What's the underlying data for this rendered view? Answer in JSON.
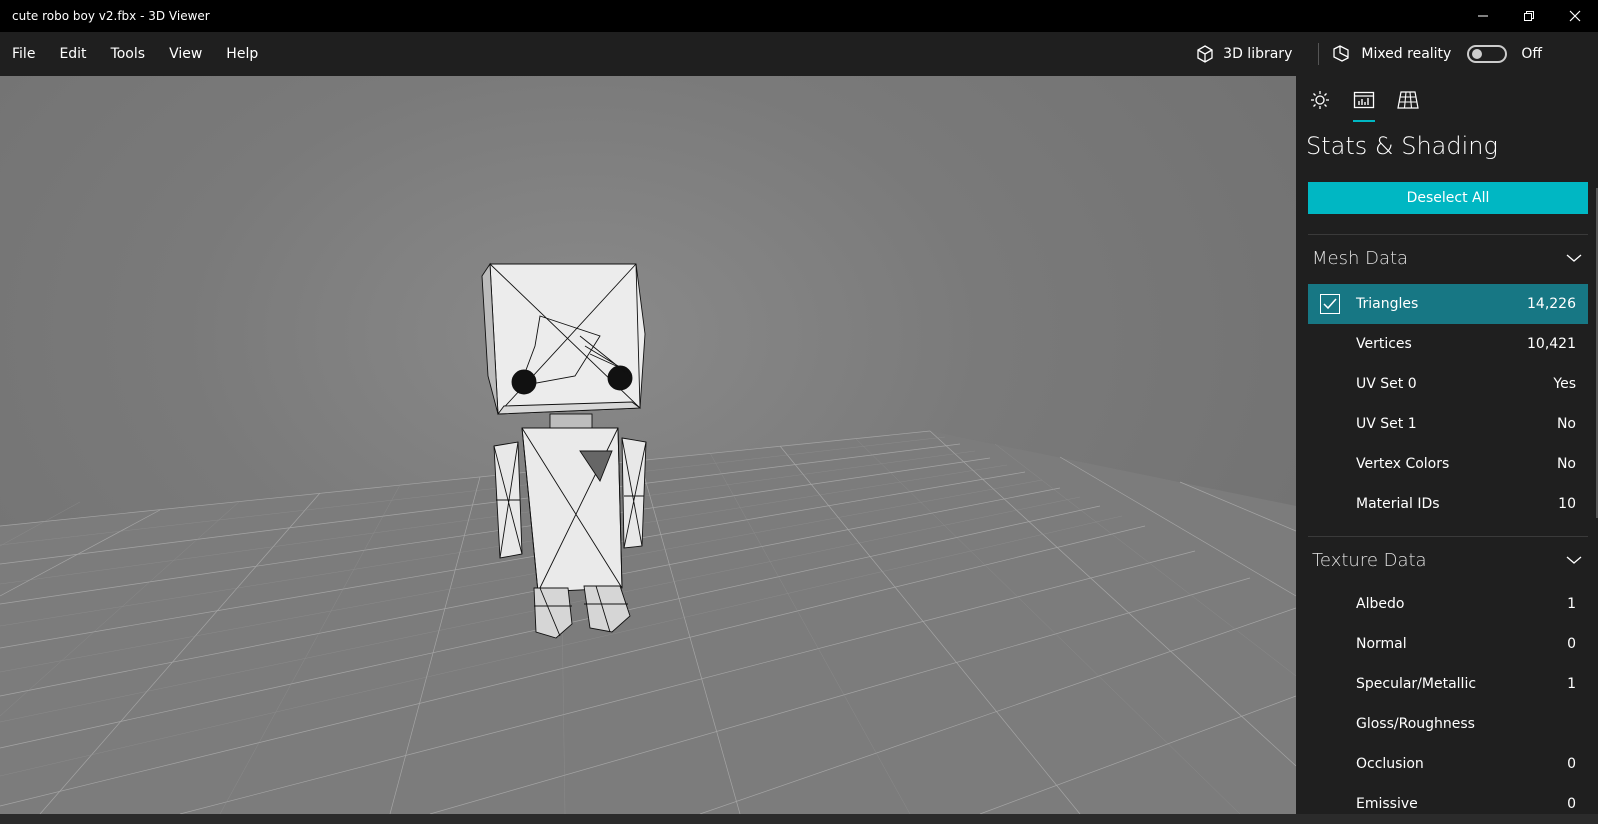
{
  "window": {
    "title": "cute robo boy v2.fbx - 3D Viewer"
  },
  "menu": {
    "file": "File",
    "edit": "Edit",
    "tools": "Tools",
    "view": "View",
    "help": "Help"
  },
  "toolbar_right": {
    "library_label": "3D library",
    "mixed_reality_label": "Mixed reality",
    "mixed_reality_state": "Off"
  },
  "panel": {
    "title": "Stats & Shading",
    "deselect_label": "Deselect All",
    "mesh_section": {
      "label": "Mesh Data",
      "rows": [
        {
          "label": "Triangles",
          "value": "14,226",
          "checked": true
        },
        {
          "label": "Vertices",
          "value": "10,421"
        },
        {
          "label": "UV Set 0",
          "value": "Yes"
        },
        {
          "label": "UV Set 1",
          "value": "No"
        },
        {
          "label": "Vertex Colors",
          "value": "No"
        },
        {
          "label": "Material IDs",
          "value": "10"
        }
      ]
    },
    "texture_section": {
      "label": "Texture Data",
      "rows": [
        {
          "label": "Albedo",
          "value": "1"
        },
        {
          "label": "Normal",
          "value": "0"
        },
        {
          "label": "Specular/Metallic",
          "value": "1"
        },
        {
          "label": "Gloss/Roughness",
          "value": ""
        },
        {
          "label": "Occlusion",
          "value": "0"
        },
        {
          "label": "Emissive",
          "value": "0"
        }
      ]
    }
  },
  "colors": {
    "accent": "#00b7c3",
    "selected_row": "#177784",
    "panel_bg": "#1f1f1f"
  },
  "icons": [
    "cube-library-icon",
    "mixed-reality-icon",
    "sun-lighting-icon",
    "stats-chart-icon",
    "grid-icon",
    "chevron-down-icon",
    "checkbox-icon",
    "minimize-icon",
    "restore-icon",
    "close-icon"
  ]
}
